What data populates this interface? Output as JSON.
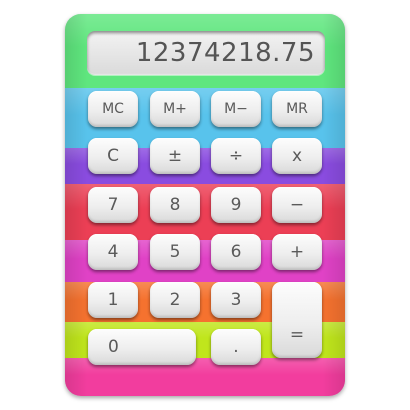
{
  "display": {
    "value": "12374218.75"
  },
  "stripes": [
    {
      "name": "green",
      "color": "#5fe67e"
    },
    {
      "name": "sky-blue",
      "color": "#58c3ec"
    },
    {
      "name": "purple",
      "color": "#8a4ce0"
    },
    {
      "name": "red",
      "color": "#ec3f55"
    },
    {
      "name": "magenta",
      "color": "#e042c6"
    },
    {
      "name": "orange",
      "color": "#f5722f"
    },
    {
      "name": "lime",
      "color": "#c0e61c"
    },
    {
      "name": "pink",
      "color": "#f23d9e"
    }
  ],
  "keys": {
    "mc": "MC",
    "m_plus": "M+",
    "m_minus": "M−",
    "mr": "MR",
    "clear": "C",
    "plus_minus": "±",
    "divide": "÷",
    "multiply": "x",
    "seven": "7",
    "eight": "8",
    "nine": "9",
    "minus": "−",
    "four": "4",
    "five": "5",
    "six": "6",
    "plus": "+",
    "one": "1",
    "two": "2",
    "three": "3",
    "zero": "0",
    "decimal": ".",
    "equals": "="
  }
}
